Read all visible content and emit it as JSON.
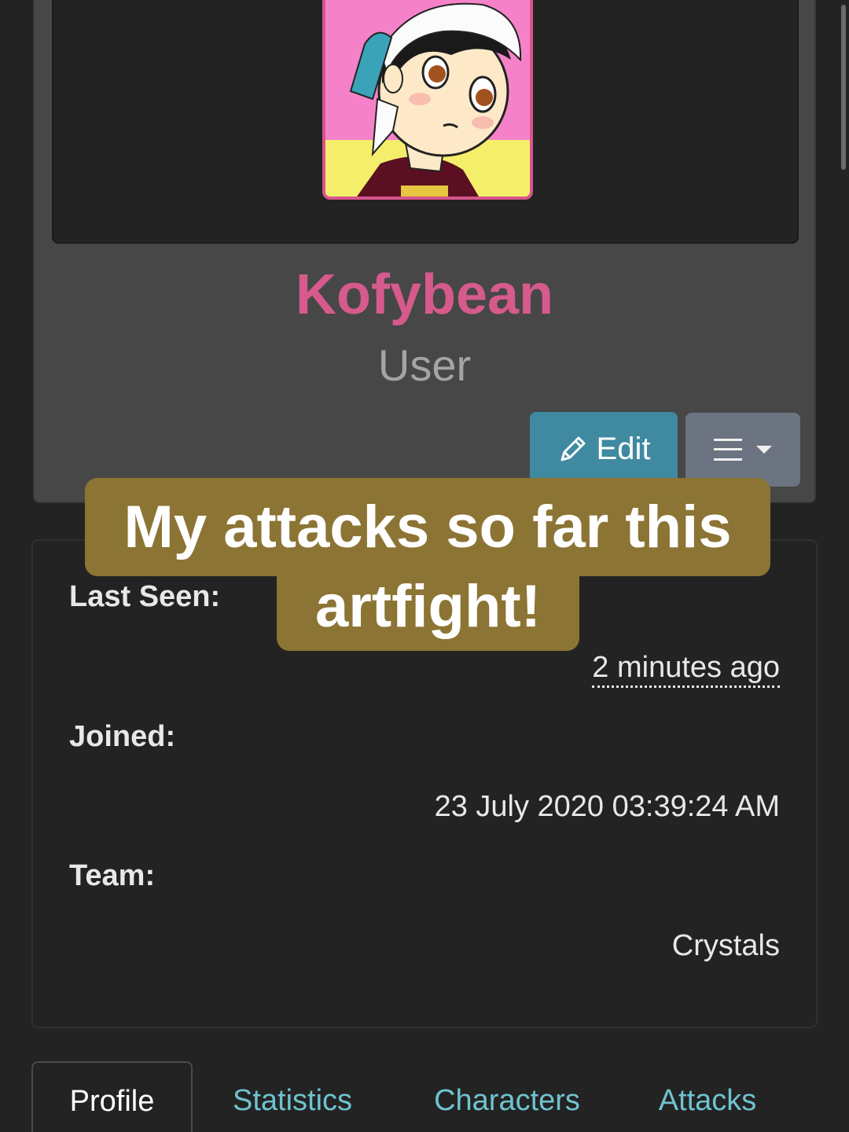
{
  "profile": {
    "username": "Kofybean",
    "role": "User",
    "edit_label": "Edit",
    "menu_icon": "hamburger-icon",
    "edit_icon": "pencil-icon"
  },
  "info": {
    "last_seen_label": "Last Seen:",
    "last_seen_value": "2 minutes ago",
    "joined_label": "Joined:",
    "joined_value": "23 July 2020 03:39:24 AM",
    "team_label": "Team:",
    "team_value": "Crystals"
  },
  "caption": {
    "line1": "My attacks so far this",
    "line2": "artfight!"
  },
  "tabs": [
    {
      "label": "Profile",
      "active": true
    },
    {
      "label": "Statistics",
      "active": false
    },
    {
      "label": "Characters",
      "active": false
    },
    {
      "label": "Attacks",
      "active": false
    }
  ],
  "colors": {
    "accent_pink": "#d65a8c",
    "edit_button": "#3f8aa1",
    "menu_button": "#6b7480",
    "tab_link": "#6fc3cf",
    "caption_bg": "#8c7434"
  }
}
